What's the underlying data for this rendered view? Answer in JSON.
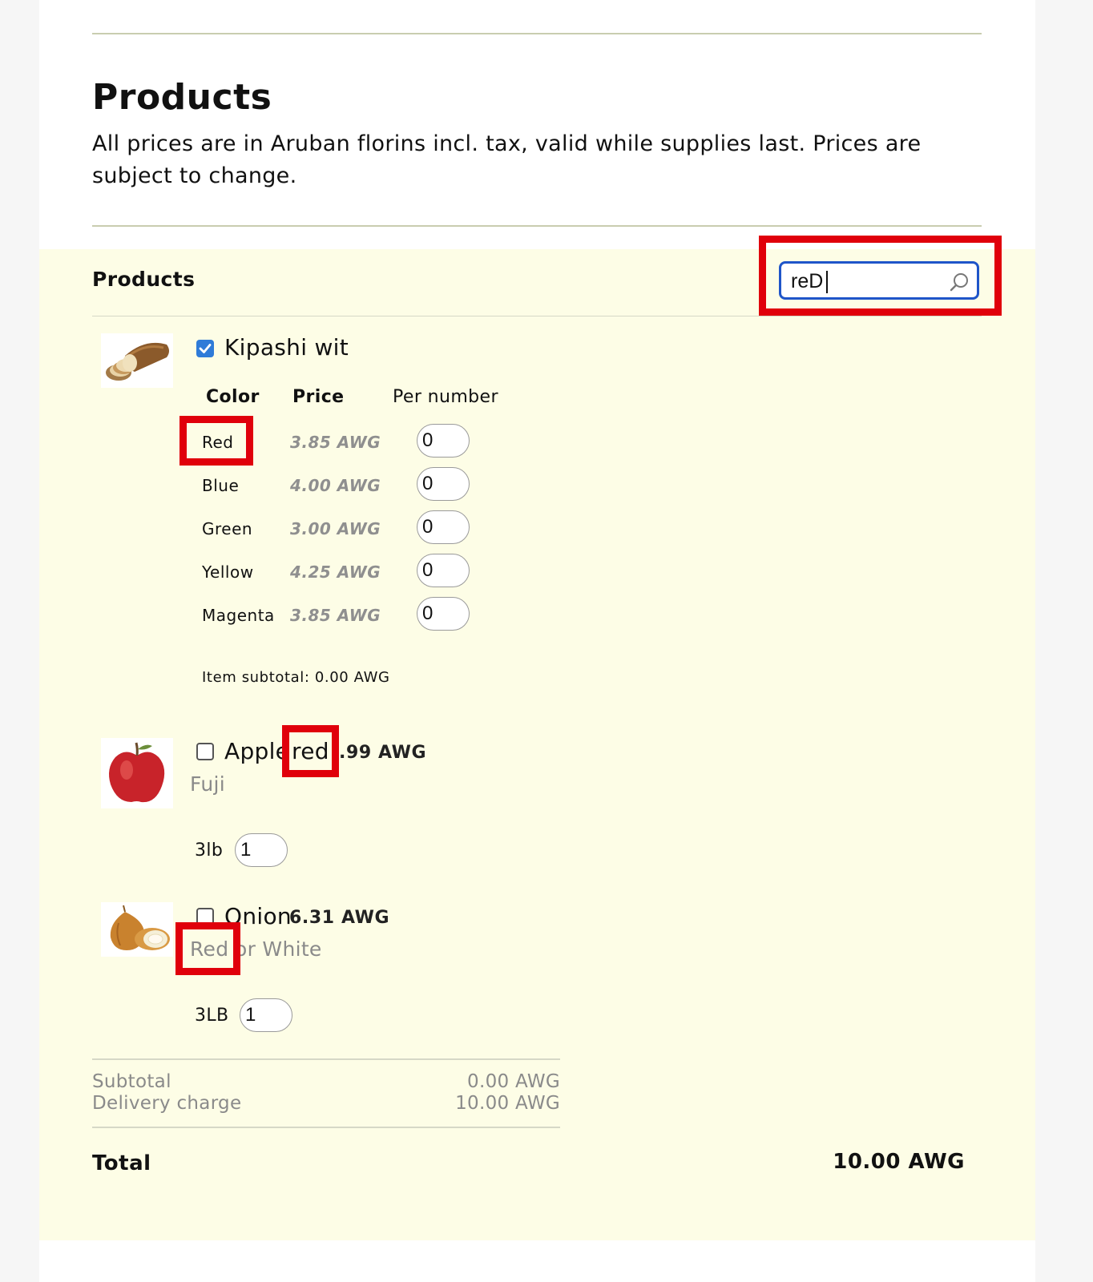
{
  "header": {
    "title": "Products",
    "description": "All prices are in Aruban florins incl. tax, valid while supplies last. Prices are subject to change."
  },
  "panel": {
    "title": "Products",
    "search": {
      "value": "reD"
    }
  },
  "products": [
    {
      "name": "Kipashi wit",
      "checked": true,
      "columns": {
        "color": "Color",
        "price": "Price",
        "per": "Per number"
      },
      "variants": [
        {
          "color": "Red",
          "price": "3.85 AWG",
          "qty": "0"
        },
        {
          "color": "Blue",
          "price": "4.00 AWG",
          "qty": "0"
        },
        {
          "color": "Green",
          "price": "3.00 AWG",
          "qty": "0"
        },
        {
          "color": "Yellow",
          "price": "4.25 AWG",
          "qty": "0"
        },
        {
          "color": "Magenta",
          "price": "3.85 AWG",
          "qty": "0"
        }
      ],
      "subtotal": "Item subtotal: 0.00 AWG"
    },
    {
      "name": "Apple",
      "name_highlight": "red",
      "price": ".99 AWG",
      "checked": false,
      "description": "Fuji",
      "unit": "3lb",
      "qty": "1"
    },
    {
      "name": "Onion",
      "price": "6.31 AWG",
      "checked": false,
      "description_highlight": "Red",
      "description_rest": "or White",
      "unit": "3LB",
      "qty": "1"
    }
  ],
  "summary": {
    "subtotal_label": "Subtotal",
    "subtotal_value": "0.00 AWG",
    "delivery_label": "Delivery charge",
    "delivery_value": "10.00 AWG",
    "total_label": "Total",
    "total_value": "10.00 AWG"
  },
  "colors": {
    "highlight_box": "#e0000b",
    "panel_background": "#fdfde6",
    "search_border": "#1f55c9",
    "checkbox_on": "#2f7bd8"
  }
}
